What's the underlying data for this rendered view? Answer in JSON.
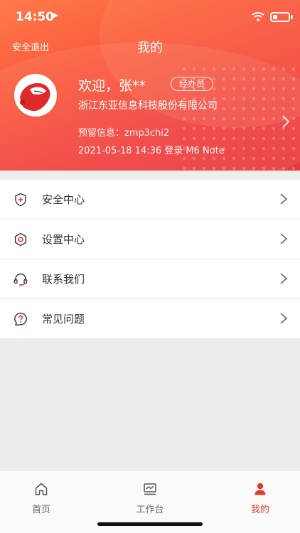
{
  "status_bar": {
    "time": "14:50"
  },
  "header": {
    "logout_label": "安全退出",
    "title": "我的",
    "welcome": "欢迎，张**",
    "role_badge": "经办员",
    "company": "浙江东亚信息科技股份有限公司",
    "reserved_info": "预留信息：zmp3chi2",
    "login_info": "2021-05-18 14:36 登录 M6 Note"
  },
  "menu": {
    "items": [
      {
        "label": "安全中心",
        "icon": "shield-icon"
      },
      {
        "label": "设置中心",
        "icon": "settings-icon"
      },
      {
        "label": "联系我们",
        "icon": "headset-icon"
      },
      {
        "label": "常见问题",
        "icon": "question-icon"
      }
    ]
  },
  "tabbar": {
    "tabs": [
      {
        "label": "首页",
        "icon": "home-icon"
      },
      {
        "label": "工作台",
        "icon": "workbench-icon"
      },
      {
        "label": "我的",
        "icon": "person-icon",
        "active": true
      }
    ]
  },
  "colors": {
    "accent": "#e4382b",
    "header_start": "#ff7a4a",
    "header_end": "#e83a3c"
  }
}
